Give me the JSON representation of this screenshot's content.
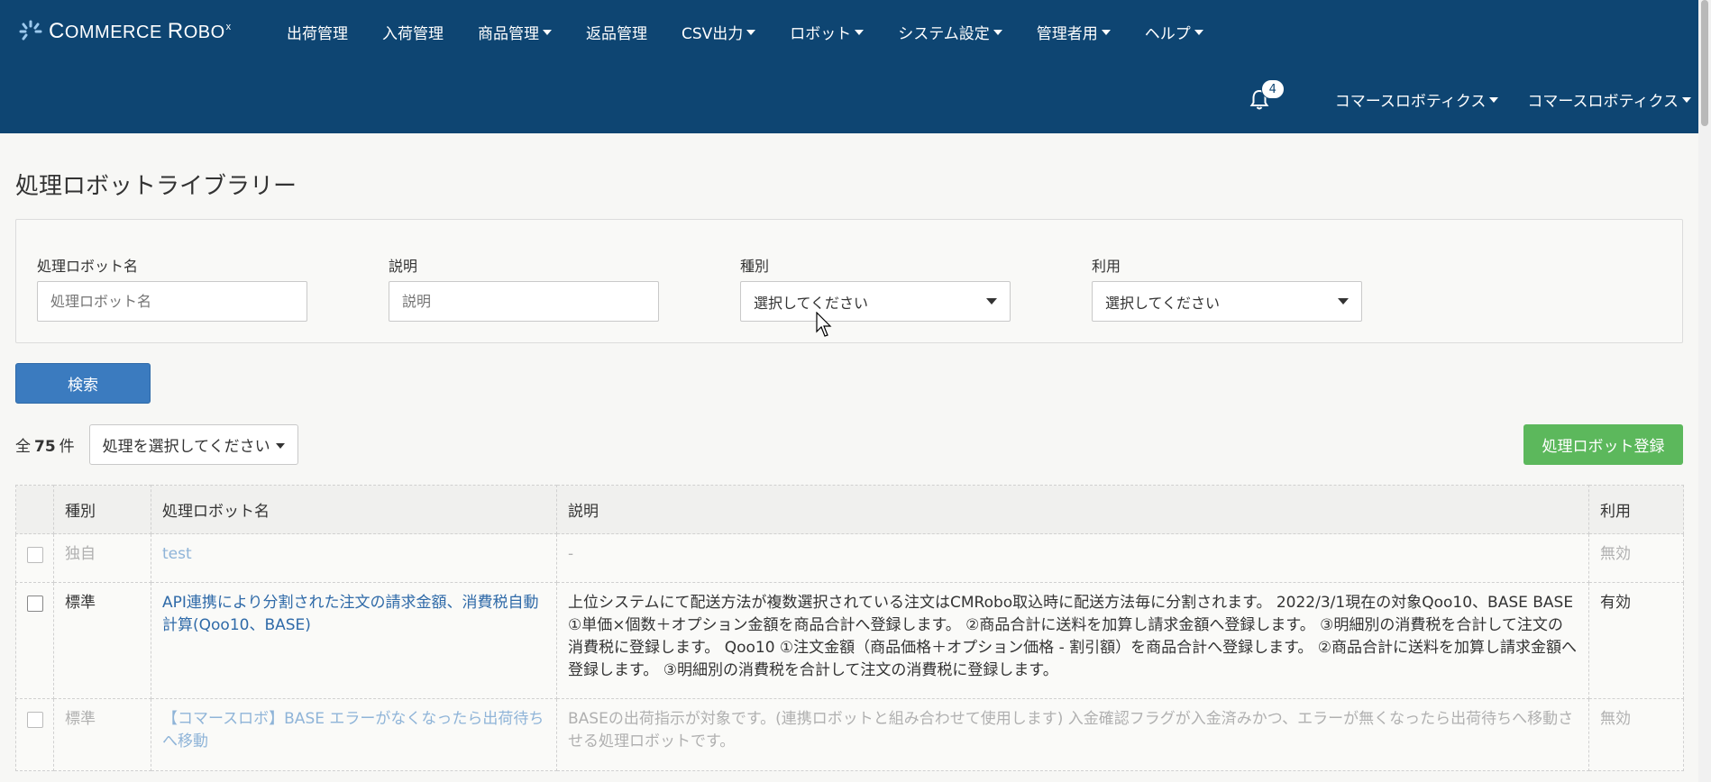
{
  "header": {
    "logo": {
      "text_pre": "C",
      "text_main": "OMMERCE ",
      "text_r": "R",
      "text_obo": "OBO",
      "sup": "x"
    },
    "nav": [
      {
        "label": "出荷管理",
        "dropdown": false
      },
      {
        "label": "入荷管理",
        "dropdown": false
      },
      {
        "label": "商品管理",
        "dropdown": true
      },
      {
        "label": "返品管理",
        "dropdown": false
      },
      {
        "label": "CSV出力",
        "dropdown": true
      },
      {
        "label": "ロボット",
        "dropdown": true
      },
      {
        "label": "システム設定",
        "dropdown": true
      },
      {
        "label": "管理者用",
        "dropdown": true
      },
      {
        "label": "ヘルプ",
        "dropdown": true
      }
    ],
    "notifications": "4",
    "user_menu_1": "コマースロボティクス",
    "user_menu_2": "コマースロボティクス"
  },
  "page_title": "処理ロボットライブラリー",
  "search": {
    "name_label": "処理ロボット名",
    "name_placeholder": "処理ロボット名",
    "desc_label": "説明",
    "desc_placeholder": "説明",
    "type_label": "種別",
    "type_value": "選択してください",
    "use_label": "利用",
    "use_value": "選択してください",
    "search_button": "検索"
  },
  "list": {
    "count_prefix": "全",
    "count": "75",
    "count_suffix": "件",
    "action_select": "処理を選択してください",
    "register_button": "処理ロボット登録"
  },
  "table": {
    "headers": [
      "種別",
      "処理ロボット名",
      "説明",
      "利用"
    ],
    "rows": [
      {
        "type": "独自",
        "name": "test",
        "desc": "-",
        "use": "無効",
        "enabled": false
      },
      {
        "type": "標準",
        "name": "API連携により分割された注文の請求金額、消費税自動計算(Qoo10、BASE)",
        "desc": "上位システムにて配送方法が複数選択されている注文はCMRobo取込時に配送方法毎に分割されます。 2022/3/1現在の対象Qoo10、BASE BASE ①単価×個数＋オプション金額を商品合計へ登録します。 ②商品合計に送料を加算し請求金額へ登録します。 ③明細別の消費税を合計して注文の消費税に登録します。 Qoo10 ①注文金額（商品価格＋オプション価格 - 割引額）を商品合計へ登録します。 ②商品合計に送料を加算し請求金額へ登録します。 ③明細別の消費税を合計して注文の消費税に登録します。",
        "use": "有効",
        "enabled": true
      },
      {
        "type": "標準",
        "name": "【コマースロボ】BASE エラーがなくなったら出荷待ちへ移動",
        "desc": "BASEの出荷指示が対象です。(連携ロボットと組み合わせて使用します) 入金確認フラグが入金済みかつ、エラーが無くなったら出荷待ちへ移動させる処理ロボットです。",
        "use": "無効",
        "enabled": false
      }
    ]
  },
  "colors": {
    "header_bg": "#0e4572",
    "primary": "#3b7bbf",
    "success": "#5cb85c",
    "link": "#2f6aa8"
  }
}
